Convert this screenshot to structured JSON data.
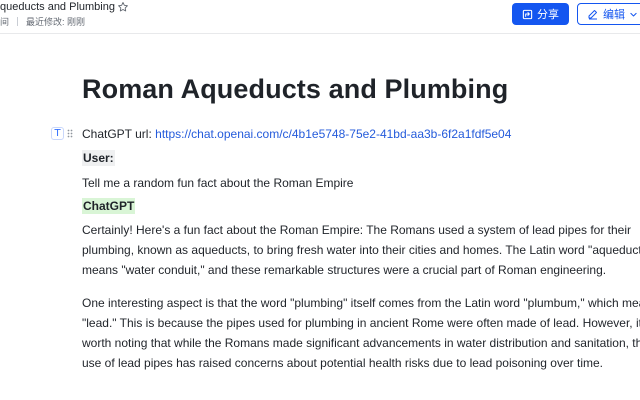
{
  "header": {
    "doc_title": "queducts and Plumbing",
    "meta_left": "间",
    "meta_modified": "最近修改: 刚刚",
    "share_label": "分享",
    "edit_label": "编辑"
  },
  "doc": {
    "title": "Roman Aqueducts and Plumbing",
    "url_label": "ChatGPT url: ",
    "url": "https://chat.openai.com/c/4b1e5748-75e2-41bd-aa3b-6f2a1fdf5e04",
    "user_label": "User:",
    "user_message": "Tell me a random fun fact about the Roman Empire",
    "gpt_label": "ChatGPT",
    "paragraph1": [
      "Certainly! Here's a fun fact about the Roman Empire: The Romans used a system of lead pipes for their",
      "plumbing, known as aqueducts, to bring fresh water into their cities and homes. The Latin word \"aqueduct\"",
      "means \"water conduit,\" and these remarkable structures were a crucial part of Roman engineering."
    ],
    "paragraph2": [
      "One interesting aspect is that the word \"plumbing\" itself comes from the Latin word \"plumbum,\" which mean",
      "\"lead.\" This is because the pipes used for plumbing in ancient Rome were often made of lead. However, it's",
      "worth noting that while the Romans made significant advancements in water distribution and sanitation, the",
      "use of lead pipes has raised concerns about potential health risks due to lead poisoning over time."
    ]
  },
  "colors": {
    "accent": "#1456f0",
    "link": "#245bdb",
    "user_highlight": "#eff0f1",
    "gpt_highlight": "#d9f5d6"
  },
  "icons": {
    "star": "star-icon",
    "share": "share-icon",
    "edit": "edit-pencil-icon",
    "chevron": "chevron-down-icon",
    "text_block": "text-block-icon",
    "drag": "drag-handle-icon"
  }
}
